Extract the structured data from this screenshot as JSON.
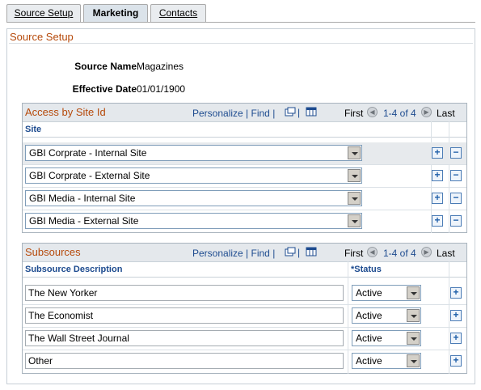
{
  "tabs": [
    {
      "label": "Source Setup",
      "active": false
    },
    {
      "label": "Marketing",
      "active": true
    },
    {
      "label": "Contacts",
      "active": false
    }
  ],
  "page": {
    "title": "Source Setup",
    "source_name_label": "Source Name",
    "source_name_value": "Magazines",
    "effective_date_label": "Effective Date",
    "effective_date_value": "01/01/1900"
  },
  "site_grid": {
    "title": "Access by Site Id",
    "personalize": "Personalize",
    "find": "Find",
    "first": "First",
    "range": "1-4 of 4",
    "last": "Last",
    "column": "Site",
    "rows": [
      "GBI Corprate - Internal Site",
      "GBI Corprate - External Site",
      "GBI Media - Internal Site",
      "GBI Media - External Site"
    ]
  },
  "subsource_grid": {
    "title": "Subsources",
    "personalize": "Personalize",
    "find": "Find",
    "first": "First",
    "range": "1-4 of 4",
    "last": "Last",
    "col_description": "Subsource Description",
    "col_status": "*Status",
    "rows": [
      {
        "description": "The New Yorker",
        "status": "Active"
      },
      {
        "description": "The Economist",
        "status": "Active"
      },
      {
        "description": "The Wall Street Journal",
        "status": "Active"
      },
      {
        "description": "Other",
        "status": "Active"
      }
    ]
  },
  "colors": {
    "section_title": "#b64a0b",
    "link": "#1d4b8f"
  }
}
